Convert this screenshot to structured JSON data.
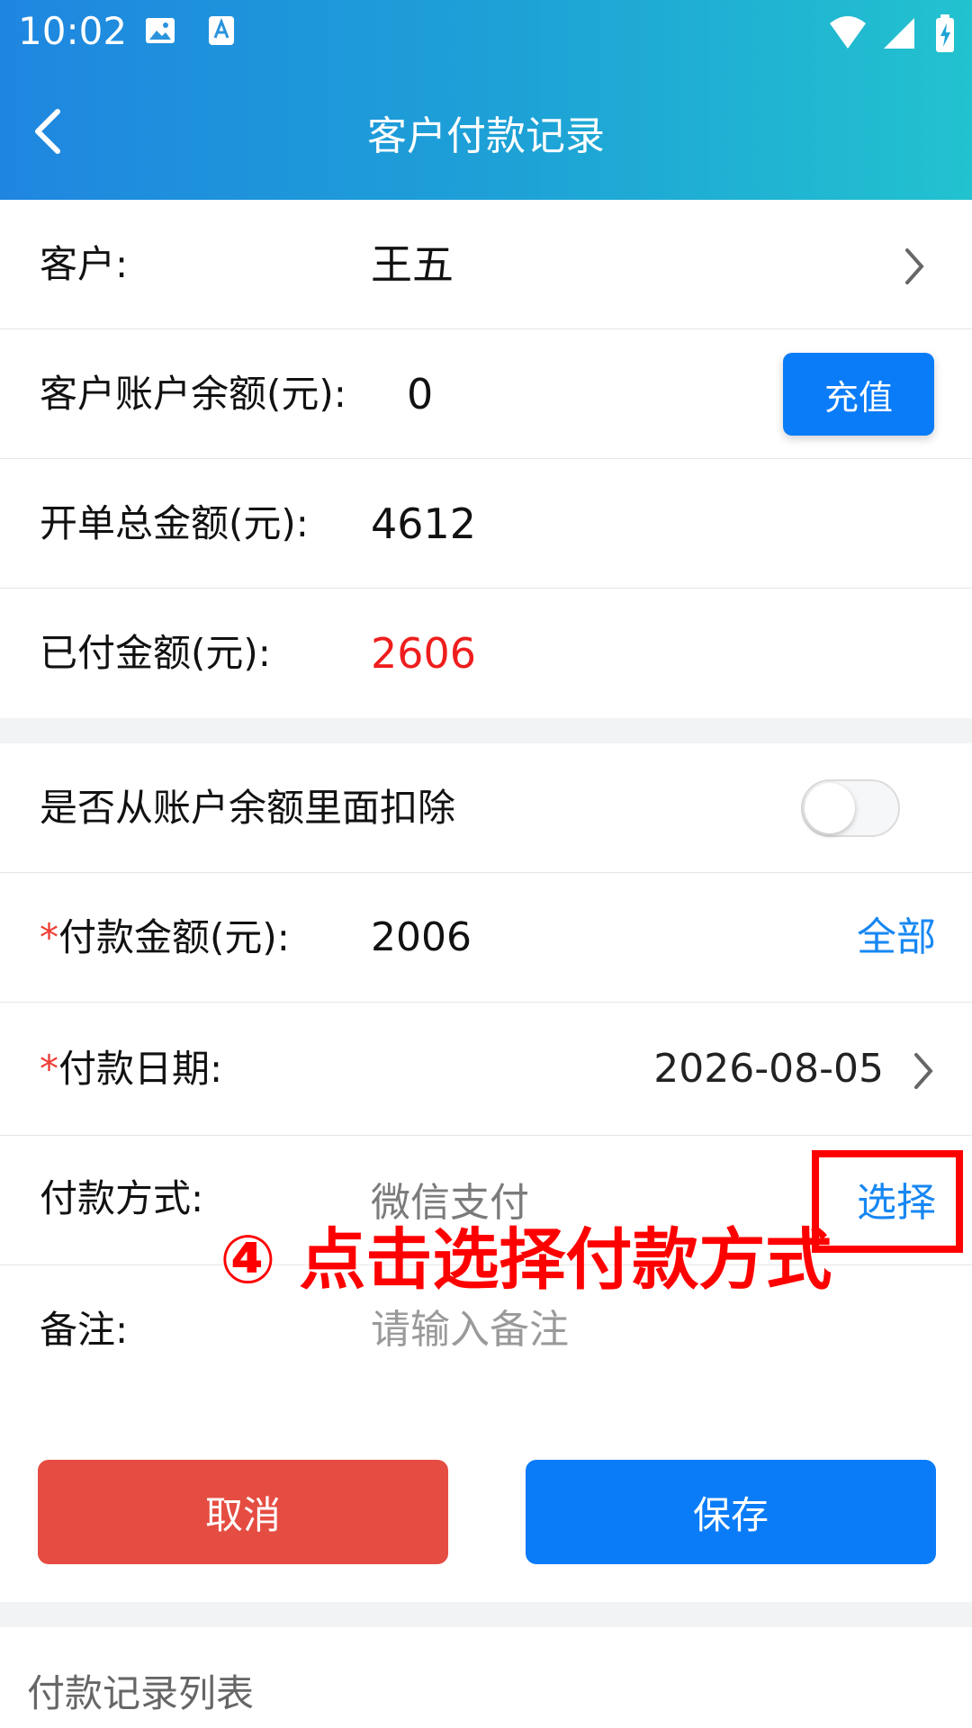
{
  "status_bar": {
    "time": "10:02"
  },
  "header": {
    "title": "客户付款记录"
  },
  "info": {
    "customer_label": "客户:",
    "customer_value": "王五",
    "balance_label": "客户账户余额(元):",
    "balance_value": "0",
    "recharge_label": "充值",
    "total_label": "开单总金额(元):",
    "total_value": "4612",
    "paid_label": "已付金额(元):",
    "paid_value": "2606"
  },
  "form": {
    "deduct_label": "是否从账户余额里面扣除",
    "deduct_enabled": false,
    "required_mark": "*",
    "amount_label": "付款金额(元):",
    "amount_value": "2006",
    "amount_all_label": "全部",
    "date_label": "付款日期:",
    "date_value": "2026-08-05",
    "method_label": "付款方式:",
    "method_value": "微信支付",
    "method_select_label": "选择",
    "note_label": "备注:",
    "note_placeholder": "请输入备注"
  },
  "annotation": {
    "text": "④ 点击选择付款方式",
    "color": "#ff0000"
  },
  "actions": {
    "cancel_label": "取消",
    "save_label": "保存"
  },
  "list": {
    "title": "付款记录列表"
  },
  "colors": {
    "primary_blue": "#0b7cf8",
    "danger_red": "#e54d42",
    "amount_red": "#ef1d1d",
    "link_blue": "#1787f3"
  }
}
